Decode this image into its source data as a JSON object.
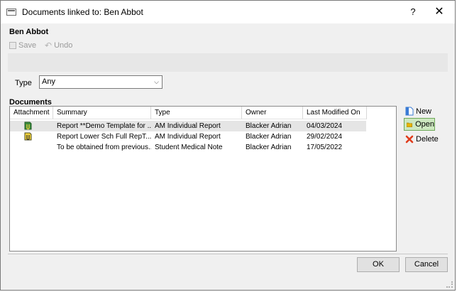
{
  "window": {
    "title": "Documents linked to: Ben Abbot",
    "help_glyph": "?",
    "close_glyph": "✕"
  },
  "person": {
    "name": "Ben Abbot"
  },
  "toolbar": {
    "save_label": "Save",
    "undo_label": "Undo"
  },
  "filter": {
    "type_label": "Type",
    "type_value": "Any"
  },
  "documents": {
    "section_label": "Documents",
    "columns": [
      "Attachment",
      "Summary",
      "Type",
      "Owner",
      "Last Modified On"
    ],
    "rows": [
      {
        "has_attachment": true,
        "summary": "Report **Demo Template for ...",
        "type": "AM Individual Report",
        "owner": "Blacker Adrian",
        "last_modified": "04/03/2024"
      },
      {
        "has_attachment": true,
        "summary": "Report Lower Sch Full RepT...",
        "type": "AM Individual Report",
        "owner": "Blacker Adrian",
        "last_modified": "29/02/2024"
      },
      {
        "has_attachment": false,
        "summary": "To be obtained from previous...",
        "type": "Student Medical Note",
        "owner": "Blacker Adrian",
        "last_modified": "17/05/2022"
      }
    ],
    "selected_row": 0
  },
  "side_actions": {
    "new_label": "New",
    "open_label": "Open",
    "delete_label": "Delete"
  },
  "footer": {
    "ok_label": "OK",
    "cancel_label": "Cancel"
  },
  "colors": {
    "open_highlight": "#cde8c0",
    "delete_icon": "#e03c1c",
    "new_icon": "#3a7bd5",
    "folder_icon": "#e8b400"
  }
}
